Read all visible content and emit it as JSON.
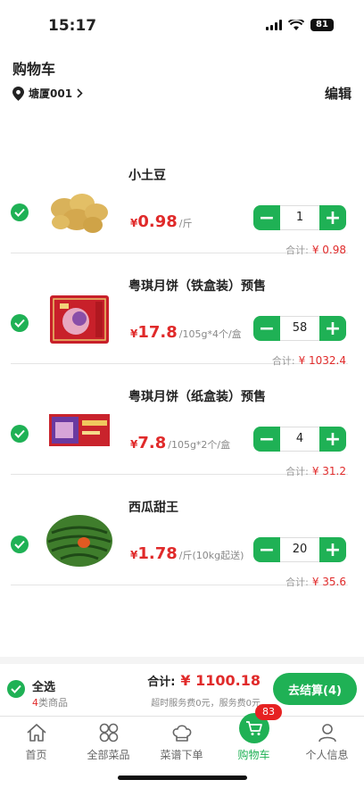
{
  "status_bar": {
    "time": "15:17",
    "battery": "81"
  },
  "header": {
    "title": "购物车",
    "location": "塘厦001",
    "edit_label": "编辑"
  },
  "cart": {
    "items": [
      {
        "name": "小土豆",
        "price_symbol": "¥",
        "price": "0.98",
        "unit": "/斤",
        "quantity": "1",
        "subtotal_label": "合计:",
        "subtotal": "¥ 0.98",
        "image": "potato"
      },
      {
        "name": "粤琪月饼（铁盒装）预售",
        "price_symbol": "¥",
        "price": "17.8",
        "unit": "/105g*4个/盒",
        "quantity": "58",
        "subtotal_label": "合计:",
        "subtotal": "¥ 1032.4",
        "image": "mooncake-tin-box"
      },
      {
        "name": "粤琪月饼（纸盒装）预售",
        "price_symbol": "¥",
        "price": "7.8",
        "unit": "/105g*2个/盒",
        "quantity": "4",
        "subtotal_label": "合计:",
        "subtotal": "¥ 31.2",
        "image": "mooncake-paper-box"
      },
      {
        "name": "西瓜甜王",
        "price_symbol": "¥",
        "price": "1.78",
        "unit": "/斤(10kg起送)",
        "quantity": "20",
        "subtotal_label": "合计:",
        "subtotal": "¥ 35.6",
        "image": "watermelon"
      }
    ]
  },
  "checkout": {
    "select_all_label": "全选",
    "category_count": "4",
    "category_suffix": "类商品",
    "total_label": "合计:",
    "total": "¥ 1100.18",
    "service_note": "超时服务费0元，服务费0元",
    "button_label": "去结算(4)"
  },
  "tabs": [
    {
      "label": "首页",
      "icon": "home-icon"
    },
    {
      "label": "全部菜品",
      "icon": "grid-icon"
    },
    {
      "label": "菜谱下单",
      "icon": "chef-hat-icon"
    },
    {
      "label": "购物车",
      "icon": "cart-icon",
      "badge": "83",
      "active": true
    },
    {
      "label": "个人信息",
      "icon": "person-icon"
    }
  ],
  "colors": {
    "accent": "#1fb155",
    "price": "#e02a2a",
    "badge": "#e62222"
  }
}
